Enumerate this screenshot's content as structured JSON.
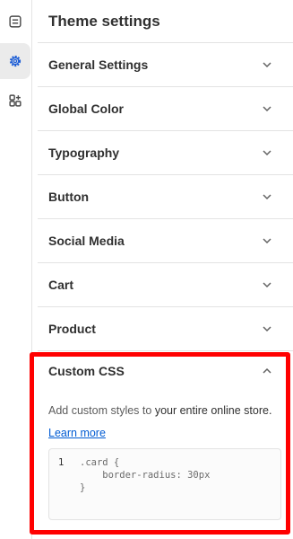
{
  "rail": {
    "items": [
      {
        "name": "sections-icon",
        "active": false
      },
      {
        "name": "gear-icon",
        "active": true
      },
      {
        "name": "apps-icon",
        "active": false
      }
    ]
  },
  "panel": {
    "title": "Theme settings",
    "sections": [
      {
        "label": "General Settings"
      },
      {
        "label": "Global Color"
      },
      {
        "label": "Typography"
      },
      {
        "label": "Button"
      },
      {
        "label": "Social Media"
      },
      {
        "label": "Cart"
      },
      {
        "label": "Product"
      }
    ],
    "custom_css": {
      "label": "Custom CSS",
      "desc_prefix": "Add custom styles to ",
      "desc_bold": "your entire online store.",
      "learn_more": "Learn more",
      "code": [
        {
          "n": "1",
          "text": ".card {"
        },
        {
          "n": "",
          "text": "    border-radius: 30px"
        },
        {
          "n": "",
          "text": "}"
        }
      ]
    }
  },
  "colors": {
    "highlight": "#ff0000",
    "link": "#005bd3",
    "active_bg": "#ebebeb"
  }
}
